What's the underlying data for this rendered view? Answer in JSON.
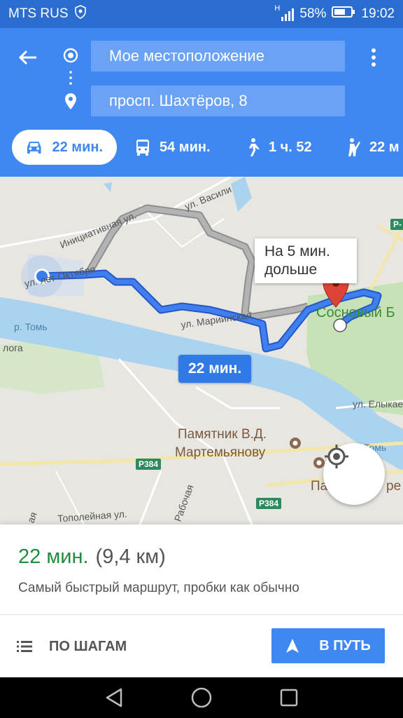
{
  "status_bar": {
    "carrier": "MTS RUS",
    "battery_percent": "58%",
    "time": "19:02",
    "network_type": "H"
  },
  "header": {
    "origin_value": "Мое местоположение",
    "destination_value": "просп. Шахтёров, 8",
    "modes": [
      {
        "icon": "car-icon",
        "label": "22 мин.",
        "active": true
      },
      {
        "icon": "bus-icon",
        "label": "54 мин.",
        "active": false
      },
      {
        "icon": "walk-icon",
        "label": "1 ч. 52",
        "active": false
      },
      {
        "icon": "ride-hail-icon",
        "label": "22 м",
        "active": false
      }
    ]
  },
  "map": {
    "street_labels": [
      "ул. Васили",
      "Инициативная ул.",
      "ул. лет Октября",
      "ул. Мариинская",
      "р. Томь",
      "ул. Елыкае",
      "ул. Рабочая",
      "Тополейная ул.",
      "Томь",
      "лога",
      "ая"
    ],
    "poi_labels": [
      "Сосновый Б",
      "Памятник В.Д.",
      "Мартемьянову",
      "Па",
      "ре"
    ],
    "road_badges": [
      "Р384",
      "Р384",
      "Р-"
    ],
    "alt_route_callout": [
      "На 5 мин.",
      "дольше"
    ],
    "route_time_badge": "22 мин."
  },
  "summary": {
    "time": "22 мин.",
    "distance": "(9,4 км)",
    "description": "Самый быстрый маршрут, пробки как обычно"
  },
  "actions": {
    "steps_label": "ПО ШАГАМ",
    "go_label": "В ПУТЬ"
  },
  "colors": {
    "header_blue": "#3f87f1",
    "status_blue": "#2a6dcf",
    "route_blue": "#3f7ff0",
    "alt_route_gray": "#a9a9a9",
    "time_green": "#1e8e3e",
    "river": "#aad3ef",
    "park": "#c8e2b8",
    "pin_red": "#db4437"
  }
}
